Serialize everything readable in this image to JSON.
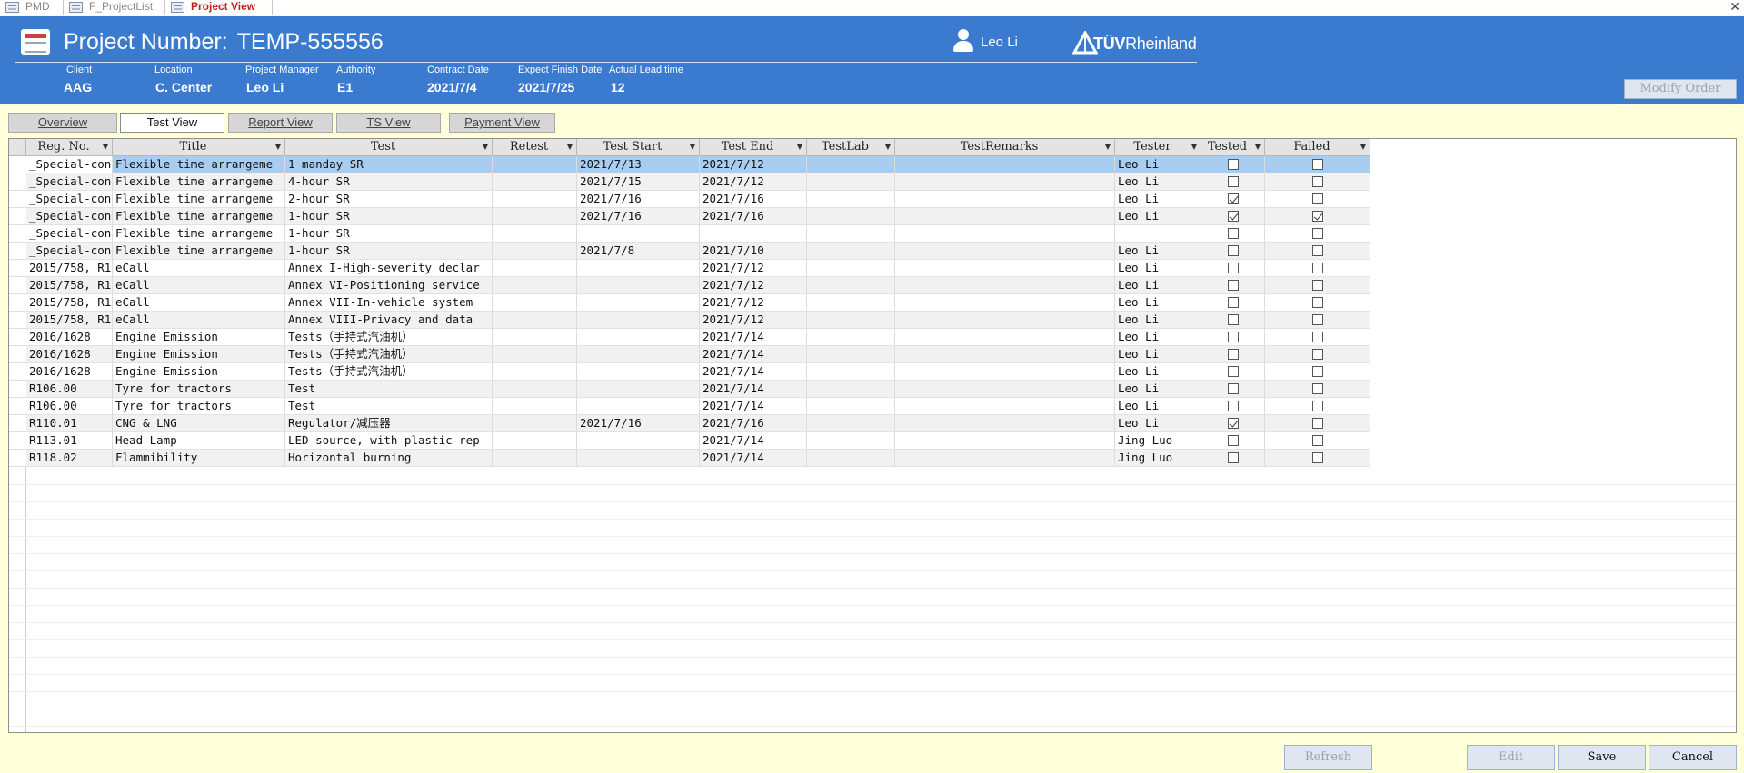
{
  "tabs": [
    {
      "label": "PMD",
      "active": false
    },
    {
      "label": "F_ProjectList",
      "active": false
    },
    {
      "label": "Project View",
      "active": true
    }
  ],
  "header": {
    "title_label": "Project Number:",
    "project_number": "TEMP-555556",
    "user_name": "Leo Li",
    "logo_text_bold": "TÜV",
    "logo_text_light": "Rheinland",
    "fields": [
      {
        "label": "Client",
        "value": "AAG"
      },
      {
        "label": "Location",
        "value": "C. Center"
      },
      {
        "label": "Project Manager",
        "value": "Leo Li"
      },
      {
        "label": "Authority",
        "value": "E1"
      },
      {
        "label": "Contract Date",
        "value": "2021/7/4"
      },
      {
        "label": "Expect Finish Date",
        "value": "2021/7/25"
      },
      {
        "label": "Actual Lead time",
        "value": "12"
      }
    ],
    "modify_order_label": "Modify Order"
  },
  "view_tabs": [
    {
      "label": "Overview",
      "active": false
    },
    {
      "label": "Test View",
      "active": true
    },
    {
      "label": "Report View",
      "active": false
    },
    {
      "label": "TS View",
      "active": false
    },
    {
      "label": "Payment View",
      "active": false
    }
  ],
  "grid": {
    "columns": [
      "Reg. No.",
      "Title",
      "Test",
      "Retest",
      "Test Start",
      "Test End",
      "TestLab",
      "TestRemarks",
      "Tester",
      "Tested",
      "Failed"
    ],
    "rows": [
      {
        "reg": "_Special-con",
        "title": "Flexible time arrangeme",
        "test": "1 manday SR",
        "retest": "",
        "start": "2021/7/13",
        "end": "2021/7/12",
        "lab": "",
        "remarks": "",
        "tester": "Leo Li",
        "tested": false,
        "failed": false
      },
      {
        "reg": "_Special-con",
        "title": "Flexible time arrangeme",
        "test": "4-hour SR",
        "retest": "",
        "start": "2021/7/15",
        "end": "2021/7/12",
        "lab": "",
        "remarks": "",
        "tester": "Leo Li",
        "tested": false,
        "failed": false
      },
      {
        "reg": "_Special-con",
        "title": "Flexible time arrangeme",
        "test": "2-hour SR",
        "retest": "",
        "start": "2021/7/16",
        "end": "2021/7/16",
        "lab": "",
        "remarks": "",
        "tester": "Leo Li",
        "tested": true,
        "failed": false
      },
      {
        "reg": "_Special-con",
        "title": "Flexible time arrangeme",
        "test": "1-hour SR",
        "retest": "",
        "start": "2021/7/16",
        "end": "2021/7/16",
        "lab": "",
        "remarks": "",
        "tester": "Leo Li",
        "tested": true,
        "failed": true
      },
      {
        "reg": "_Special-con",
        "title": "Flexible time arrangeme",
        "test": "1-hour SR",
        "retest": "",
        "start": "",
        "end": "",
        "lab": "",
        "remarks": "",
        "tester": "",
        "tested": false,
        "failed": false
      },
      {
        "reg": "_Special-con",
        "title": "Flexible time arrangeme",
        "test": "1-hour SR",
        "retest": "",
        "start": "2021/7/8",
        "end": "2021/7/10",
        "lab": "",
        "remarks": "",
        "tester": "Leo Li",
        "tested": false,
        "failed": false
      },
      {
        "reg": "2015/758, R1",
        "title": "eCall",
        "test": "Annex I-High-severity declar",
        "retest": "",
        "start": "",
        "end": "2021/7/12",
        "lab": "",
        "remarks": "",
        "tester": "Leo Li",
        "tested": false,
        "failed": false
      },
      {
        "reg": "2015/758, R1",
        "title": "eCall",
        "test": "Annex VI-Positioning service",
        "retest": "",
        "start": "",
        "end": "2021/7/12",
        "lab": "",
        "remarks": "",
        "tester": "Leo Li",
        "tested": false,
        "failed": false
      },
      {
        "reg": "2015/758, R1",
        "title": "eCall",
        "test": "Annex VII-In-vehicle system",
        "retest": "",
        "start": "",
        "end": "2021/7/12",
        "lab": "",
        "remarks": "",
        "tester": "Leo Li",
        "tested": false,
        "failed": false
      },
      {
        "reg": "2015/758, R1",
        "title": "eCall",
        "test": "Annex VIII-Privacy and data",
        "retest": "",
        "start": "",
        "end": "2021/7/12",
        "lab": "",
        "remarks": "",
        "tester": "Leo Li",
        "tested": false,
        "failed": false
      },
      {
        "reg": "2016/1628",
        "title": "Engine Emission",
        "test": "Tests（手持式汽油机）",
        "retest": "",
        "start": "",
        "end": "2021/7/14",
        "lab": "",
        "remarks": "",
        "tester": "Leo Li",
        "tested": false,
        "failed": false
      },
      {
        "reg": "2016/1628",
        "title": "Engine Emission",
        "test": "Tests（手持式汽油机）",
        "retest": "",
        "start": "",
        "end": "2021/7/14",
        "lab": "",
        "remarks": "",
        "tester": "Leo Li",
        "tested": false,
        "failed": false
      },
      {
        "reg": "2016/1628",
        "title": "Engine Emission",
        "test": "Tests（手持式汽油机）",
        "retest": "",
        "start": "",
        "end": "2021/7/14",
        "lab": "",
        "remarks": "",
        "tester": "Leo Li",
        "tested": false,
        "failed": false
      },
      {
        "reg": "R106.00",
        "title": "Tyre for tractors",
        "test": "Test",
        "retest": "",
        "start": "",
        "end": "2021/7/14",
        "lab": "",
        "remarks": "",
        "tester": "Leo Li",
        "tested": false,
        "failed": false
      },
      {
        "reg": "R106.00",
        "title": "Tyre for tractors",
        "test": "Test",
        "retest": "",
        "start": "",
        "end": "2021/7/14",
        "lab": "",
        "remarks": "",
        "tester": "Leo Li",
        "tested": false,
        "failed": false
      },
      {
        "reg": "R110.01",
        "title": "CNG & LNG",
        "test": "Regulator/减压器",
        "retest": "",
        "start": "2021/7/16",
        "end": "2021/7/16",
        "lab": "",
        "remarks": "",
        "tester": "Leo Li",
        "tested": true,
        "failed": false
      },
      {
        "reg": "R113.01",
        "title": "Head Lamp",
        "test": "LED source, with plastic rep",
        "retest": "",
        "start": "",
        "end": "2021/7/14",
        "lab": "",
        "remarks": "",
        "tester": "Jing Luo",
        "tested": false,
        "failed": false
      },
      {
        "reg": "R118.02",
        "title": "Flammibility",
        "test": "Horizontal burning",
        "retest": "",
        "start": "",
        "end": "2021/7/14",
        "lab": "",
        "remarks": "",
        "tester": "Jing Luo",
        "tested": false,
        "failed": false
      }
    ]
  },
  "buttons": {
    "refresh": "Refresh",
    "edit": "Edit",
    "save": "Save",
    "cancel": "Cancel"
  }
}
